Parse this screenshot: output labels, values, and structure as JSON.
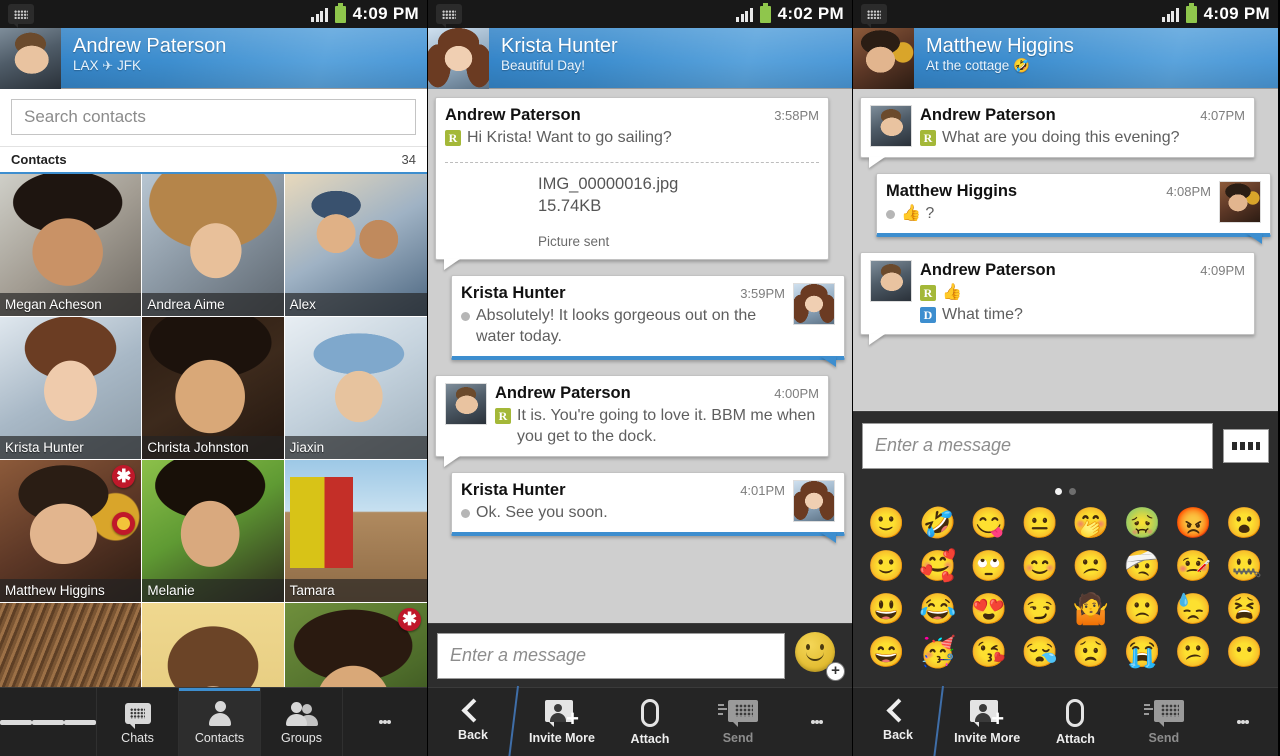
{
  "panels": {
    "contacts": {
      "statusbar": {
        "time": "4:09 PM",
        "logo_icon": "bbm-logo-icon",
        "signal_icon": "signal-icon",
        "battery_icon": "battery-icon"
      },
      "header": {
        "name": "Andrew Paterson",
        "status_left": "LAX",
        "status_icon": "airplane-icon",
        "status_right": "JFK"
      },
      "search": {
        "placeholder": "Search contacts",
        "value": ""
      },
      "list_header": {
        "label": "Contacts",
        "count": "34"
      },
      "contacts": [
        {
          "name": "Megan Acheson",
          "art": "ph-megan",
          "badge": ""
        },
        {
          "name": "Andrea Aime",
          "art": "ph-andrea",
          "badge": ""
        },
        {
          "name": "Alex",
          "art": "ph-alex",
          "badge": ""
        },
        {
          "name": "Krista Hunter",
          "art": "ph-kristaC",
          "badge": ""
        },
        {
          "name": "Christa Johnston",
          "art": "ph-christa",
          "badge": ""
        },
        {
          "name": "Jiaxin",
          "art": "ph-jiaxin",
          "badge": ""
        },
        {
          "name": "Matthew Higgins",
          "art": "ph-matthew",
          "badge": "star-dot"
        },
        {
          "name": "Melanie",
          "art": "ph-melanie",
          "badge": ""
        },
        {
          "name": "Tamara",
          "art": "ph-tamara",
          "badge": ""
        },
        {
          "name": "",
          "art": "ph-fur",
          "badge": ""
        },
        {
          "name": "",
          "art": "ph-bangs",
          "badge": ""
        },
        {
          "name": "",
          "art": "ph-jess",
          "badge": "star"
        }
      ],
      "nav": [
        {
          "label": "",
          "icon": "hamburger-icon",
          "selected": false
        },
        {
          "label": "Chats",
          "icon": "chat-bubble-icon",
          "selected": false
        },
        {
          "label": "Contacts",
          "icon": "person-icon",
          "selected": true
        },
        {
          "label": "Groups",
          "icon": "group-icon",
          "selected": false
        },
        {
          "label": "",
          "icon": "overflow-menu-icon",
          "selected": false
        }
      ]
    },
    "krista_chat": {
      "statusbar": {
        "time": "4:02 PM",
        "logo_icon": "bbm-logo-icon",
        "signal_icon": "signal-icon",
        "battery_icon": "battery-icon"
      },
      "header": {
        "name": "Krista Hunter",
        "status": "Beautiful Day!",
        "avatar_art": "ph-krista"
      },
      "messages": [
        {
          "sender": "Andrew Paterson",
          "time": "3:58PM",
          "side": "left",
          "marker": "R",
          "text": "Hi Krista! Want to go sailing?",
          "show_avatar": false,
          "attachment": {
            "thumb_art": "ph-sail",
            "filename": "IMG_00000016.jpg",
            "size": "15.74KB",
            "state": "Picture sent"
          }
        },
        {
          "sender": "Krista Hunter",
          "time": "3:59PM",
          "side": "right",
          "marker": "dot",
          "text": "Absolutely! It looks gorgeous out on the water today.",
          "show_avatar": true,
          "avatar_art": "ph-krista"
        },
        {
          "sender": "Andrew Paterson",
          "time": "4:00PM",
          "side": "left",
          "marker": "R",
          "text": "It is. You're going to love it. BBM me when you get to the dock.",
          "show_avatar": true,
          "avatar_art": "ph-andrew"
        },
        {
          "sender": "Krista Hunter",
          "time": "4:01PM",
          "side": "right",
          "marker": "dot",
          "text": "Ok. See you soon.",
          "show_avatar": true,
          "avatar_art": "ph-krista"
        }
      ],
      "composer": {
        "placeholder": "Enter a message",
        "value": "",
        "emoji_button_icon": "smiley-plus-icon"
      },
      "nav": [
        {
          "label": "Back",
          "icon": "back-chevron-icon",
          "dim": false
        },
        {
          "label": "Invite More",
          "icon": "invite-person-icon",
          "dim": false
        },
        {
          "label": "Attach",
          "icon": "paperclip-icon",
          "dim": false
        },
        {
          "label": "Send",
          "icon": "send-bbm-icon",
          "dim": true
        },
        {
          "label": "",
          "icon": "overflow-menu-icon",
          "dim": false
        }
      ]
    },
    "matthew_chat": {
      "statusbar": {
        "time": "4:09 PM",
        "logo_icon": "bbm-logo-icon",
        "signal_icon": "signal-icon",
        "battery_icon": "battery-icon"
      },
      "header": {
        "name": "Matthew Higgins",
        "status": "At the cottage",
        "status_emoji": "🤣",
        "avatar_art": "ph-matthew"
      },
      "messages": [
        {
          "sender": "Andrew Paterson",
          "time": "4:07PM",
          "side": "left",
          "marker": "R",
          "text": "What are you doing this evening?",
          "show_avatar": true,
          "avatar_art": "ph-andrew"
        },
        {
          "sender": "Matthew Higgins",
          "time": "4:08PM",
          "side": "right",
          "marker": "dot",
          "text": "👍 ?",
          "show_avatar": true,
          "avatar_art": "ph-matthew"
        },
        {
          "sender": "Andrew Paterson",
          "time": "4:09PM",
          "side": "left",
          "marker": "R",
          "text": "👍",
          "marker2": "D",
          "text2": "What time?",
          "show_avatar": true,
          "avatar_art": "ph-andrew"
        }
      ],
      "composer": {
        "placeholder": "Enter a message",
        "value": "",
        "keyboard_button_icon": "keyboard-icon"
      },
      "emoji_panel": {
        "page_dots": [
          true,
          false
        ],
        "emojis": [
          "🙂",
          "🤣",
          "😋",
          "😐",
          "🤭",
          "🤢",
          "😡",
          "😮",
          "🙂",
          "🥰",
          "🙄",
          "😊",
          "😕",
          "🤕",
          "🤒",
          "🤐",
          "😃",
          "😂",
          "😍",
          "😏",
          "🤷",
          "🙁",
          "😓",
          "😫",
          "😄",
          "🥳",
          "😘",
          "😪",
          "😟",
          "😭",
          "😕",
          "😶"
        ]
      },
      "nav": [
        {
          "label": "Back",
          "icon": "back-chevron-icon",
          "dim": false
        },
        {
          "label": "Invite More",
          "icon": "invite-person-icon",
          "dim": false
        },
        {
          "label": "Attach",
          "icon": "paperclip-icon",
          "dim": false
        },
        {
          "label": "Send",
          "icon": "send-bbm-icon",
          "dim": true
        },
        {
          "label": "",
          "icon": "overflow-menu-icon",
          "dim": false
        }
      ]
    }
  },
  "colors": {
    "accent_blue": "#3d8ecf",
    "header_blue": "#3d8ecf",
    "status_r_badge": "#a4b838",
    "status_d_badge": "#3d8ecf",
    "badge_red": "#c0182a",
    "nav_dark": "#222222",
    "chat_bg": "#cfcfcf"
  }
}
